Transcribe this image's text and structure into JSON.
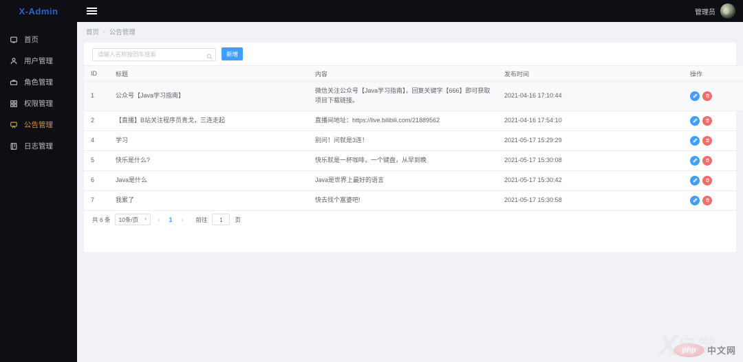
{
  "topbar": {
    "logo": "X-Admin",
    "menu_icon": "hamburger-icon",
    "admin_label": "管理员"
  },
  "sidebar": {
    "items": [
      {
        "label": "首页",
        "icon": "home-icon",
        "active": false
      },
      {
        "label": "用户管理",
        "icon": "user-icon",
        "active": false
      },
      {
        "label": "角色管理",
        "icon": "briefcase-icon",
        "active": false
      },
      {
        "label": "权限管理",
        "icon": "grid-icon",
        "active": false
      },
      {
        "label": "公告管理",
        "icon": "megaphone-icon",
        "active": true
      },
      {
        "label": "日志管理",
        "icon": "book-icon",
        "active": false
      }
    ]
  },
  "breadcrumb": {
    "home": "首页",
    "separator": "›",
    "current": "公告管理"
  },
  "toolbar": {
    "search_placeholder": "请输入名称按回车搜索",
    "search_value": "",
    "search_icon": "search-icon",
    "add_label": "新增"
  },
  "table": {
    "columns": [
      "ID",
      "标题",
      "内容",
      "发布时间",
      "操作"
    ],
    "rows": [
      {
        "id": "1",
        "title": "公众号【Java学习指南】",
        "content": "微信关注公众号【Java学习指南】，回复关键字【666】即可获取项目下载链接。",
        "time": "2021-04-16 17:10:44"
      },
      {
        "id": "2",
        "title": "【直播】B站关注程序员青戈，三连走起",
        "content": "直播间地址：https://live.bilibili.com/21889562",
        "time": "2021-04-16 17:54:10"
      },
      {
        "id": "4",
        "title": "学习",
        "content": "别问！问就是3连！",
        "time": "2021-05-17 15:29:29"
      },
      {
        "id": "5",
        "title": "快乐是什么?",
        "content": "快乐就是一杯咖啡，一个键盘，从早到晚",
        "time": "2021-05-17 15:30:08"
      },
      {
        "id": "6",
        "title": "Java是什么",
        "content": "Java是世界上最好的语言",
        "time": "2021-05-17 15:30:42"
      },
      {
        "id": "7",
        "title": "我累了",
        "content": "快去找个富婆吧!",
        "time": "2021-05-17 15:30:58"
      }
    ],
    "row_actions": {
      "edit_icon": "pencil-icon",
      "delete_icon": "trash-icon"
    }
  },
  "pagination": {
    "total_text": "共 6 条",
    "page_size": "10条/页",
    "prev_icon": "chevron-left-icon",
    "next_icon": "chevron-right-icon",
    "current_page": "1",
    "jump_label": "前往",
    "jump_value": "1",
    "jump_unit": "页"
  },
  "watermark": {
    "x_mark": "X",
    "text": "自学",
    "badge_text": "php",
    "badge_cn": "中文网"
  },
  "colors": {
    "sidebar_bg": "#0e0e14",
    "logo_blue": "#2b64c4",
    "active_gold": "#c79a3a",
    "primary_blue": "#409eff",
    "danger_red": "#f56c6c",
    "content_bg": "#f0f2f5"
  }
}
